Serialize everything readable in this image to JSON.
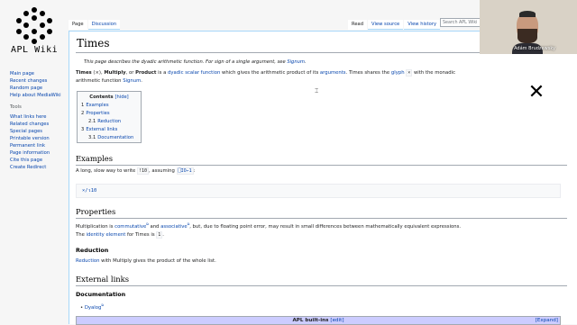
{
  "logo": {
    "text": "APL Wiki"
  },
  "sidebar": {
    "nav": [
      "Main page",
      "Recent changes",
      "Random page",
      "Help about MediaWiki"
    ],
    "tools_heading": "Tools",
    "tools": [
      "What links here",
      "Related changes",
      "Special pages",
      "Printable version",
      "Permanent link",
      "Page information",
      "Cite this page",
      "Create Redirect"
    ]
  },
  "tabs": {
    "page": "Page",
    "discussion": "Discussion",
    "read": "Read",
    "view_source": "View source",
    "view_history": "View history"
  },
  "search": {
    "placeholder": "Search APL Wiki"
  },
  "video": {
    "name": "Adám Brudzewsky"
  },
  "article": {
    "title": "Times",
    "hatnote_pre": "This page describes the dyadic arithmetic function. For sign of a single argument, see ",
    "hatnote_link": "Signum",
    "hatnote_post": ".",
    "intro": {
      "b1": "Times",
      "glyph1": "(×)",
      "sep": ", ",
      "b2": "Multiply",
      "or": ", or ",
      "b3": "Product",
      "t1": " is a ",
      "l1": "dyadic",
      "l2": "scalar function",
      "t2": " which gives the arithmetic product of its ",
      "l3": "arguments",
      "t3": ". Times shares the ",
      "l4": "glyph",
      "glyph2": "×",
      "t4": " with the monadic",
      "line2_pre": "arithmetic function ",
      "line2_link": "Signum",
      "line2_post": "."
    },
    "toc": {
      "title": "Contents",
      "hide": "[hide]",
      "items": [
        {
          "num": "1",
          "label": "Examples"
        },
        {
          "num": "2",
          "label": "Properties"
        },
        {
          "num": "2.1",
          "label": "Reduction"
        },
        {
          "num": "3",
          "label": "External links"
        },
        {
          "num": "3.1",
          "label": "Documentation"
        }
      ]
    },
    "close_glyph": "✕",
    "examples": {
      "heading": "Examples",
      "text_pre": "A long, slow way to write ",
      "code1": "!10",
      "text_mid": ", assuming ",
      "code2": "⎕IO←1",
      "text_post": ":",
      "codeblock": "×/⍳10"
    },
    "properties": {
      "heading": "Properties",
      "p1_pre": "Multiplication is ",
      "p1_l1": "commutative",
      "p1_and": " and ",
      "p1_l2": "associative",
      "p1_post": ", but, due to floating point error, may result in small differences between mathematically equivalent expressions.",
      "p2_pre": "The ",
      "p2_link": "identity element",
      "p2_mid": " for Times is ",
      "p2_code": "1",
      "p2_post": "."
    },
    "reduction": {
      "heading": "Reduction",
      "link": "Reduction",
      "text": " with Multiply gives the product of the whole list."
    },
    "external": {
      "heading": "External links",
      "doc_heading": "Documentation",
      "bullet": "Dyalog"
    },
    "navbox": {
      "title": "APL built-ins",
      "edit": "[edit]",
      "expand": "[Expand]"
    }
  }
}
